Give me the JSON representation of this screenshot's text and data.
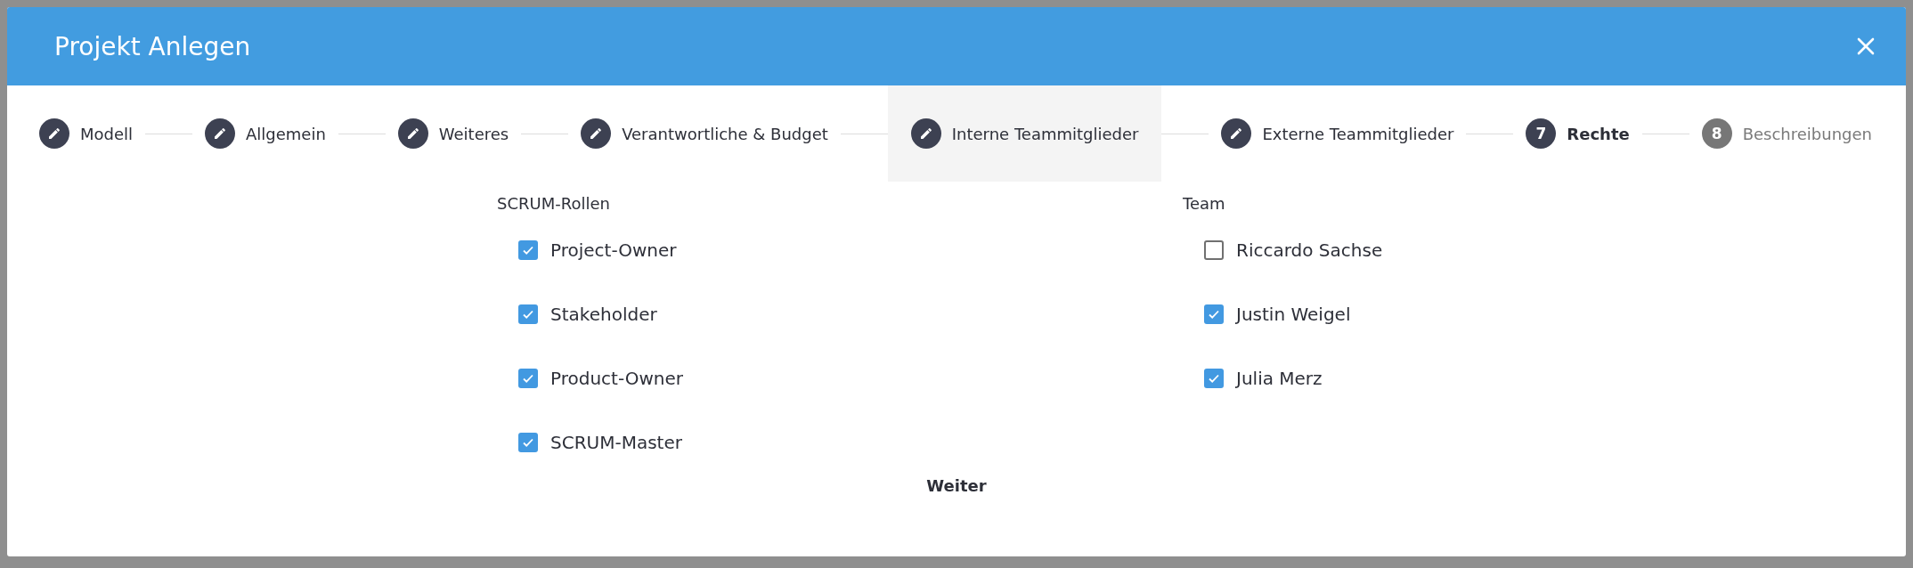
{
  "dialog": {
    "title": "Projekt Anlegen"
  },
  "steps": [
    {
      "label": "Modell",
      "kind": "edit",
      "selected": false,
      "current": false,
      "disabled": false
    },
    {
      "label": "Allgemein",
      "kind": "edit",
      "selected": false,
      "current": false,
      "disabled": false
    },
    {
      "label": "Weiteres",
      "kind": "edit",
      "selected": false,
      "current": false,
      "disabled": false
    },
    {
      "label": "Verantwortliche & Budget",
      "kind": "edit",
      "selected": false,
      "current": false,
      "disabled": false
    },
    {
      "label": "Interne Teammitglieder",
      "kind": "edit",
      "selected": true,
      "current": false,
      "disabled": false
    },
    {
      "label": "Externe Teammitglieder",
      "kind": "edit",
      "selected": false,
      "current": false,
      "disabled": false
    },
    {
      "label": "Rechte",
      "kind": "number",
      "number": "7",
      "selected": false,
      "current": true,
      "disabled": false
    },
    {
      "label": "Beschreibungen",
      "kind": "number",
      "number": "8",
      "selected": false,
      "current": false,
      "disabled": true
    }
  ],
  "groups": [
    {
      "title": "SCRUM-Rollen",
      "options": [
        {
          "label": "Project-Owner",
          "checked": true
        },
        {
          "label": "Stakeholder",
          "checked": true
        },
        {
          "label": "Product-Owner",
          "checked": true
        },
        {
          "label": "SCRUM-Master",
          "checked": true
        }
      ]
    },
    {
      "title": "Team",
      "options": [
        {
          "label": "Riccardo Sachse",
          "checked": false
        },
        {
          "label": "Justin Weigel",
          "checked": true
        },
        {
          "label": "Julia Merz",
          "checked": true
        }
      ]
    }
  ],
  "next_button": "Weiter"
}
